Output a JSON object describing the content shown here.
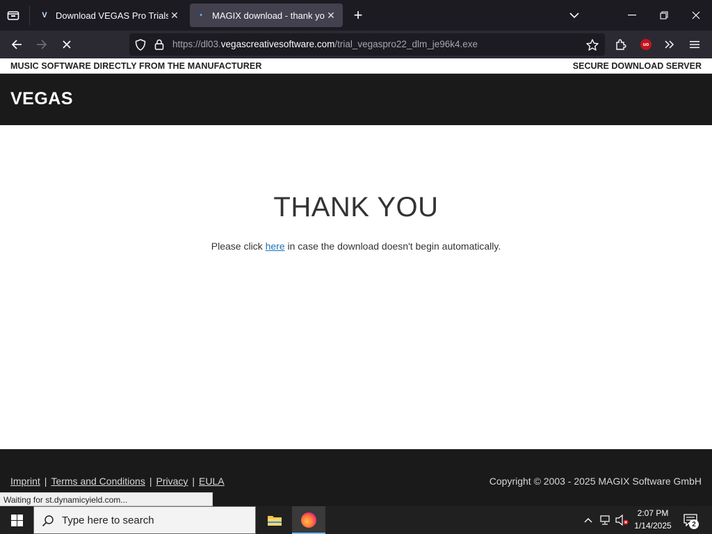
{
  "browser": {
    "tabs": [
      {
        "title": "Download VEGAS Pro Trials for Windows",
        "favicon": "V",
        "active": false
      },
      {
        "title": "MAGIX download - thank you",
        "favicon": "•",
        "active": true
      }
    ],
    "url_prefix": "https://dl03.",
    "url_host": "vegascreativesoftware.com",
    "url_path": "/trial_vegaspro22_dlm_je96k4.exe"
  },
  "page": {
    "topbar_left": "MUSIC SOFTWARE DIRECTLY FROM THE MANUFACTURER",
    "topbar_right": "SECURE DOWNLOAD SERVER",
    "logo": "VEGAS",
    "heading": "THANK YOU",
    "message_before": "Please click ",
    "message_link": "here",
    "message_after": " in case the download doesn't begin automatically.",
    "footer_links": [
      "Imprint",
      "Terms and Conditions",
      "Privacy",
      "EULA"
    ],
    "copyright": "Copyright © 2003 - 2025 MAGIX Software GmbH"
  },
  "status_text": "Waiting for st.dynamicyield.com...",
  "taskbar": {
    "search_placeholder": "Type here to search",
    "time": "2:07 PM",
    "date": "1/14/2025",
    "notification_count": "2"
  }
}
